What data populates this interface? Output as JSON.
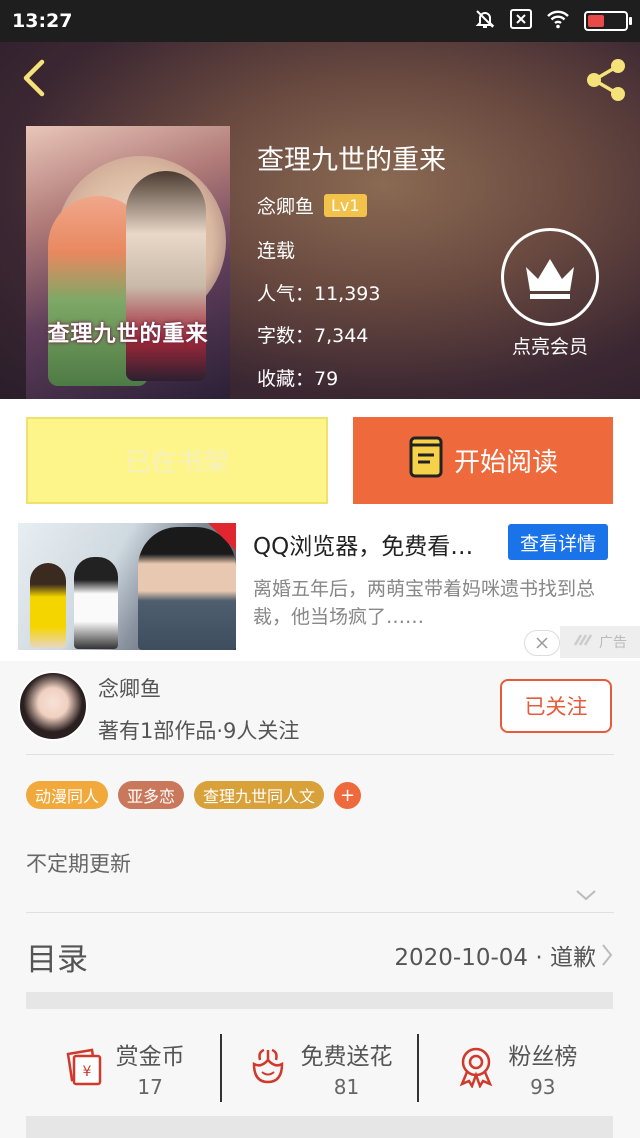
{
  "status_bar": {
    "time": "13:27",
    "battery_level": 0.45
  },
  "book": {
    "title": "查理九世的重来",
    "cover_title": "查理九世的重来",
    "author": "念卿鱼",
    "level": "Lv1",
    "status": "连载",
    "popularity": "人气：11,393",
    "word_count": "字数：7,344",
    "favorites": "收藏：79"
  },
  "vip": {
    "label": "点亮会员"
  },
  "actions": {
    "shelf_label": "已在书架",
    "read_label": "开始阅读"
  },
  "ad": {
    "title": "QQ浏览器，免费看…",
    "button": "查看详情",
    "description": "离婚五年后，两萌宝带着妈咪遗书找到总裁，他当场疯了……",
    "label": "广告"
  },
  "author_section": {
    "name": "念卿鱼",
    "works": "著有1部作品·9人关注",
    "follow_label": "已关注"
  },
  "tags": [
    {
      "label": "动漫同人",
      "color": "#f2a93b"
    },
    {
      "label": "亚多恋",
      "color": "#c9785c"
    },
    {
      "label": "查理九世同人文",
      "color": "#d8a13a"
    }
  ],
  "tag_add": "+",
  "update_text": "不定期更新",
  "toc": {
    "title": "目录",
    "latest": "2020-10-04 · 道歉"
  },
  "stats": [
    {
      "label": "赏金币",
      "value": "17",
      "icon": "red-envelope-icon"
    },
    {
      "label": "免费送花",
      "value": "81",
      "icon": "flower-icon"
    },
    {
      "label": "粉丝榜",
      "value": "93",
      "icon": "medal-icon"
    }
  ],
  "colors": {
    "accent": "#ee6a3c",
    "shelf": "#fdf48a",
    "icon_red": "#d0392b"
  }
}
